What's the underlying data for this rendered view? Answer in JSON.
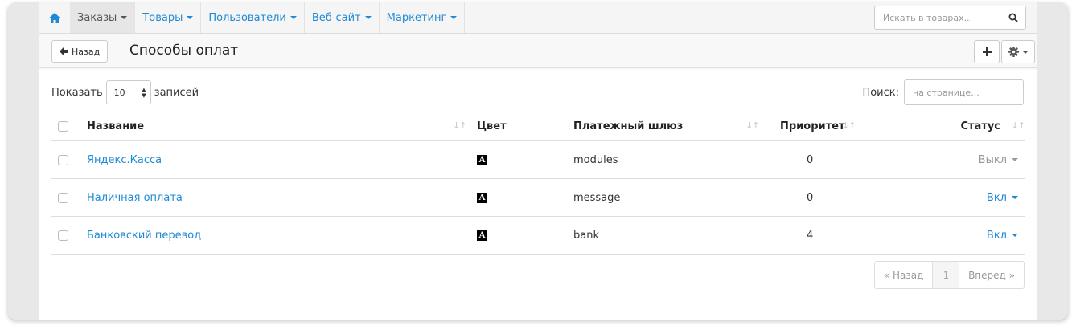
{
  "nav": {
    "items": [
      {
        "label": "Заказы",
        "active": true
      },
      {
        "label": "Товары",
        "active": false
      },
      {
        "label": "Пользователи",
        "active": false
      },
      {
        "label": "Веб-сайт",
        "active": false
      },
      {
        "label": "Маркетинг",
        "active": false
      }
    ],
    "search_placeholder": "Искать в товарах..."
  },
  "header": {
    "back_label": "Назад",
    "title": "Способы оплат"
  },
  "controls": {
    "show_label": "Показать",
    "show_value": "10",
    "records_label": "записей",
    "search_label": "Поиск:",
    "search_placeholder": "на странице..."
  },
  "table": {
    "columns": {
      "name": "Название",
      "color": "Цвет",
      "gateway": "Платежный шлюз",
      "priority": "Приоритет",
      "status": "Статус"
    },
    "rows": [
      {
        "name": "Яндекс.Касса",
        "color_glyph": "A",
        "gateway": "modules",
        "priority": "0",
        "status": "Выкл",
        "status_on": false
      },
      {
        "name": "Наличная оплата",
        "color_glyph": "A",
        "gateway": "message",
        "priority": "0",
        "status": "Вкл",
        "status_on": true
      },
      {
        "name": "Банковский перевод",
        "color_glyph": "A",
        "gateway": "bank",
        "priority": "4",
        "status": "Вкл",
        "status_on": true
      }
    ]
  },
  "pager": {
    "prev": "« Назад",
    "current": "1",
    "next": "Вперед »"
  },
  "colors": {
    "link": "#1e8ad6",
    "status_off": "#999999"
  }
}
